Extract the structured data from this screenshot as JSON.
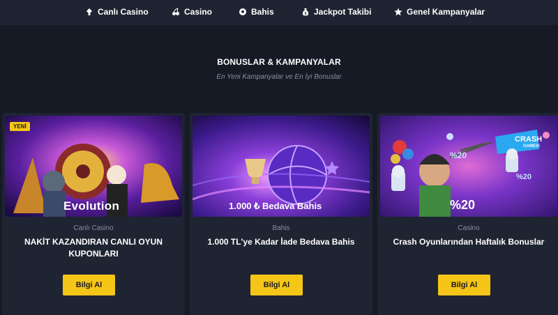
{
  "nav": {
    "items": [
      {
        "label": "Canlı Casino",
        "icon": "live-casino-icon"
      },
      {
        "label": "Casino",
        "icon": "cherry-icon"
      },
      {
        "label": "Bahis",
        "icon": "soccer-ball-icon"
      },
      {
        "label": "Jackpot Takibi",
        "icon": "money-bag-icon"
      },
      {
        "label": "Genel Kampanyalar",
        "icon": "star-icon"
      }
    ]
  },
  "section": {
    "title": "BONUSLAR & KAMPANYALAR",
    "subtitle": "En Yeni Kampanyalar ve En İyi Bonuslar"
  },
  "cards": [
    {
      "badge": "YENİ",
      "image_text": "Evolution",
      "category": "Canlı Casino",
      "title": "NAKİT KAZANDIRAN CANLI OYUN KUPONLARI",
      "button": "Bilgi Al"
    },
    {
      "image_text": "1.000 ₺ Bedava Bahis",
      "category": "Bahis",
      "title": "1.000 TL'ye Kadar İade Bedava Bahis",
      "button": "Bilgi Al"
    },
    {
      "image_text": "%20",
      "image_text_2": "CRASH",
      "image_text_3": "GAMES!",
      "category": "Casino",
      "title": "Crash Oyunlarından Haftalık Bonuslar",
      "button": "Bilgi Al"
    }
  ],
  "colors": {
    "background": "#161a25",
    "panel": "#1f2432",
    "accent": "#f5c518",
    "muted_text": "#8a90a0"
  }
}
